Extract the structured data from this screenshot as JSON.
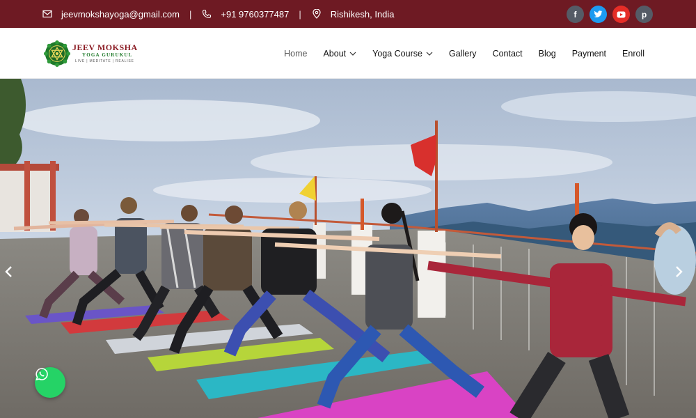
{
  "topbar": {
    "email": "jeevmokshayoga@gmail.com",
    "phone": "+91 9760377487",
    "location": "Rishikesh, India",
    "separator": "|",
    "social": [
      {
        "icon": "facebook-icon",
        "glyph": "f",
        "color": "#555b66"
      },
      {
        "icon": "twitter-icon",
        "glyph": "t",
        "color": "#1d9bf0"
      },
      {
        "icon": "youtube-icon",
        "glyph": "▶",
        "color": "#e52d27"
      },
      {
        "icon": "pinterest-icon",
        "glyph": "p",
        "color": "#555b66"
      }
    ]
  },
  "logo": {
    "line1": "JEEV MOKSHA",
    "line2": "YOGA GURUKUL",
    "line3": "LIVE | MEDITATE | REALISE"
  },
  "nav": {
    "items": [
      {
        "label": "Home",
        "active": true
      },
      {
        "label": "About",
        "dropdown": true
      },
      {
        "label": "Yoga Course",
        "dropdown": true
      },
      {
        "label": "Gallery"
      },
      {
        "label": "Contact"
      },
      {
        "label": "Blog"
      },
      {
        "label": "Payment"
      },
      {
        "label": "Enroll"
      }
    ]
  },
  "hero": {
    "prev": "‹",
    "next": "›"
  },
  "colors": {
    "topbar": "#6e1a23",
    "whatsapp": "#25d366"
  }
}
